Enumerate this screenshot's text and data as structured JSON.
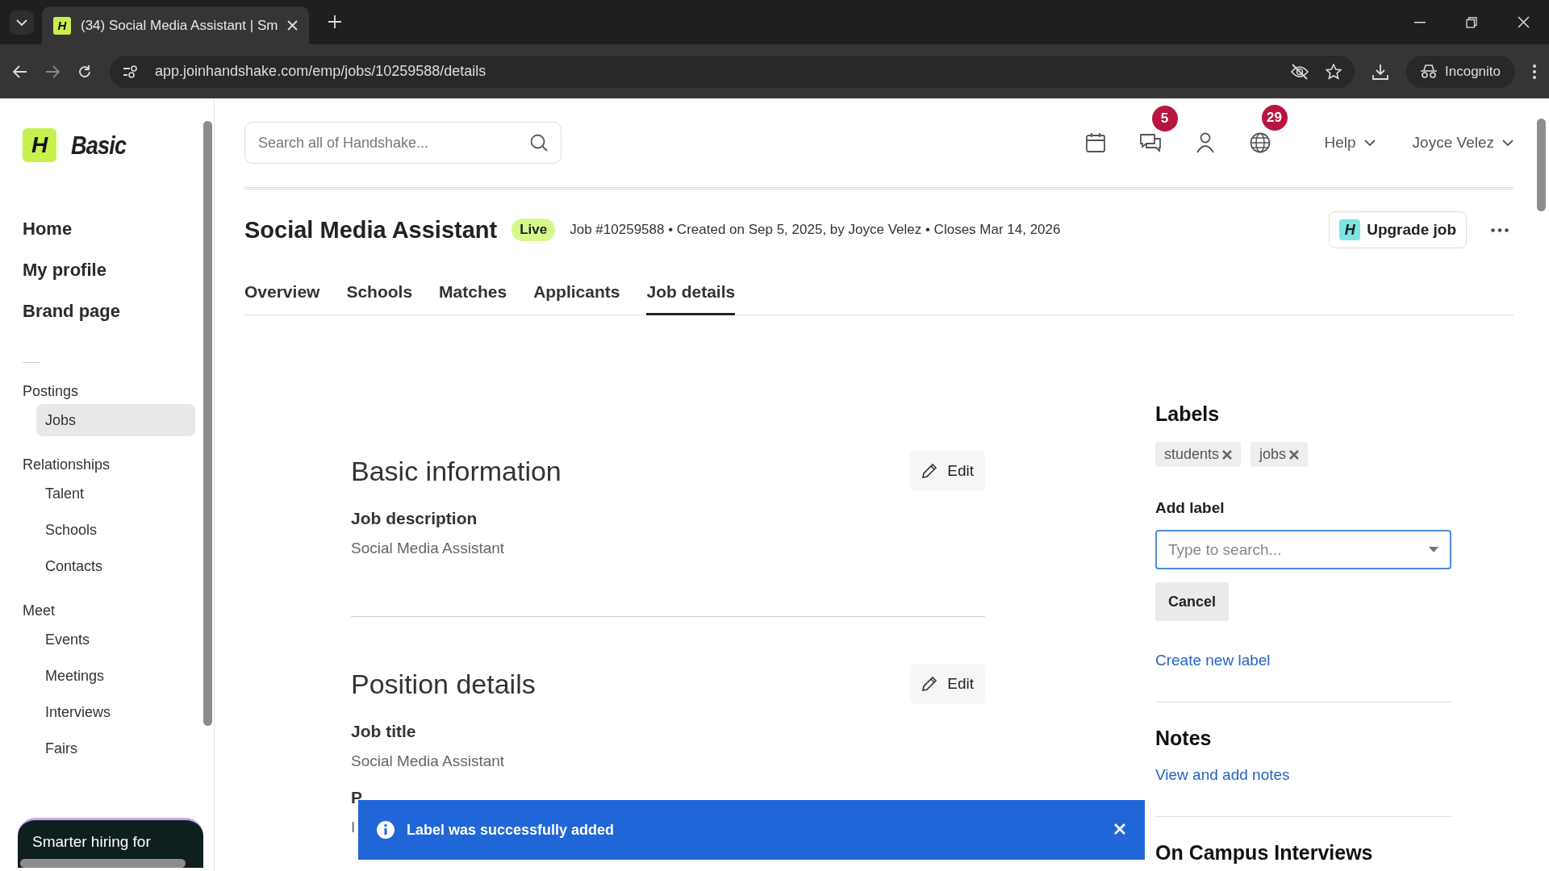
{
  "browser": {
    "favicon": "H",
    "tab_title": "(34) Social Media Assistant | Sm",
    "url": "app.joinhandshake.com/emp/jobs/10259588/details",
    "incognito": "Incognito"
  },
  "sidebar": {
    "logo_mark": "H",
    "plan": "Basic",
    "primary": [
      {
        "label": "Home"
      },
      {
        "label": "My profile"
      },
      {
        "label": "Brand page"
      }
    ],
    "sections": [
      {
        "title": "Postings",
        "items": [
          {
            "label": "Jobs",
            "selected": true
          }
        ]
      },
      {
        "title": "Relationships",
        "items": [
          {
            "label": "Talent",
            "selected": false
          },
          {
            "label": "Schools",
            "selected": false
          },
          {
            "label": "Contacts",
            "selected": false
          }
        ]
      },
      {
        "title": "Meet",
        "items": [
          {
            "label": "Events",
            "selected": false
          },
          {
            "label": "Meetings",
            "selected": false
          },
          {
            "label": "Interviews",
            "selected": false
          },
          {
            "label": "Fairs",
            "selected": false
          }
        ]
      }
    ],
    "promo": "Smarter hiring for"
  },
  "header": {
    "search_placeholder": "Search all of Handshake...",
    "messages_badge": "5",
    "notifications_badge": "29",
    "help": "Help",
    "user": "Joyce Velez"
  },
  "job": {
    "title": "Social Media Assistant",
    "status": "Live",
    "meta": "Job #10259588 • Created on Sep 5, 2025, by Joyce Velez • Closes Mar 14, 2026",
    "upgrade_mark": "H",
    "upgrade_button": "Upgrade job",
    "tabs": [
      {
        "label": "Overview",
        "selected": false
      },
      {
        "label": "Schools",
        "selected": false
      },
      {
        "label": "Matches",
        "selected": false
      },
      {
        "label": "Applicants",
        "selected": false
      },
      {
        "label": "Job details",
        "selected": true
      }
    ]
  },
  "sections": [
    {
      "title": "Basic information",
      "edit": "Edit",
      "fields": [
        {
          "label": "Job description",
          "value": "Social Media Assistant"
        }
      ]
    },
    {
      "title": "Position details",
      "edit": "Edit",
      "fields": [
        {
          "label": "Job title",
          "value": "Social Media Assistant"
        },
        {
          "label": "P",
          "value": "I"
        }
      ]
    }
  ],
  "labels_panel": {
    "title": "Labels",
    "chips": [
      {
        "text": "students"
      },
      {
        "text": "jobs"
      }
    ],
    "add_label": "Add label",
    "placeholder": "Type to search...",
    "cancel": "Cancel",
    "create_link": "Create new label"
  },
  "notes": {
    "title": "Notes",
    "link": "View and add notes"
  },
  "next_section": {
    "title": "On Campus Interviews"
  },
  "toast": {
    "message": "Label was successfully added"
  }
}
